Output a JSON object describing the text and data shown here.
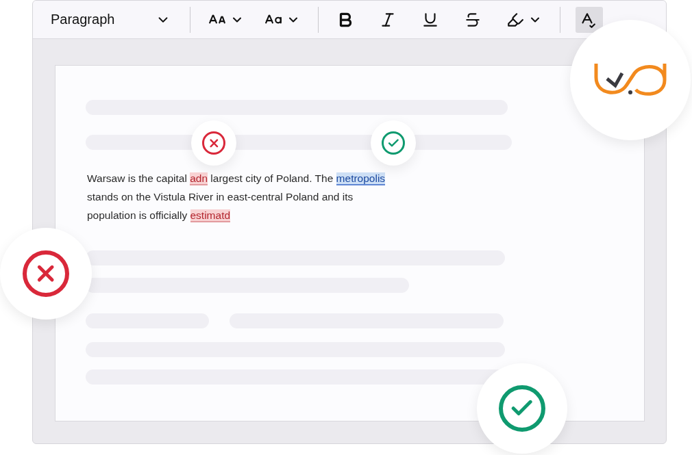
{
  "toolbar": {
    "style_select": "Paragraph",
    "tools": [
      {
        "kind": "size",
        "selected": false
      },
      {
        "kind": "spacing",
        "selected": false
      },
      {
        "kind": "bold",
        "selected": false
      },
      {
        "kind": "italic",
        "selected": false
      },
      {
        "kind": "underline",
        "selected": false
      },
      {
        "kind": "strike",
        "selected": false
      },
      {
        "kind": "highlight",
        "selected": false
      },
      {
        "kind": "spellcheck",
        "selected": true
      }
    ]
  },
  "document": {
    "lines": [
      [
        {
          "text": "Warsaw is the capital ",
          "kind": "plain"
        },
        {
          "text": "adn",
          "kind": "error"
        },
        {
          "text": " largest city of Poland. The ",
          "kind": "plain"
        },
        {
          "text": "metropolis ",
          "kind": "suggestion"
        }
      ],
      [
        {
          "text": "stands on the Vistula River in east-central Poland and its",
          "kind": "plain"
        }
      ],
      [
        {
          "text": "population is officially ",
          "kind": "plain"
        },
        {
          "text": "estimatd",
          "kind": "error"
        }
      ]
    ]
  }
}
